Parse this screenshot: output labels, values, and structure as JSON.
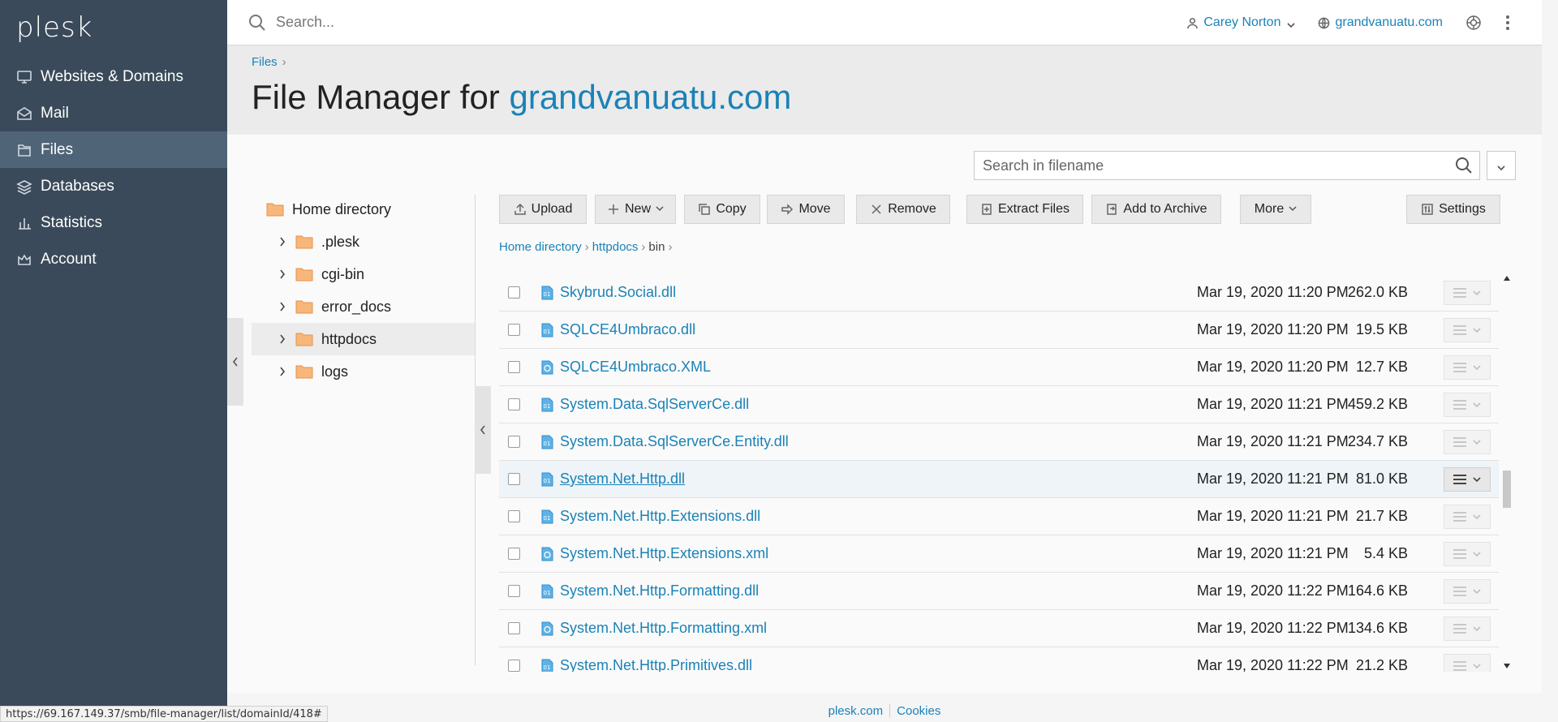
{
  "brand": {
    "logo": "plesk"
  },
  "sidebar": {
    "items": [
      {
        "label": "Websites & Domains",
        "icon": "monitor-icon",
        "active": false
      },
      {
        "label": "Mail",
        "icon": "envelope-icon",
        "active": false
      },
      {
        "label": "Files",
        "icon": "files-icon",
        "active": true
      },
      {
        "label": "Databases",
        "icon": "database-icon",
        "active": false
      },
      {
        "label": "Statistics",
        "icon": "bar-chart-icon",
        "active": false
      },
      {
        "label": "Account",
        "icon": "account-icon",
        "active": false
      }
    ]
  },
  "topbar": {
    "search_placeholder": "Search...",
    "user": "Carey Norton",
    "domain": "grandvanuatu.com"
  },
  "header": {
    "breadcrumb": "Files",
    "title_prefix": "File Manager for ",
    "title_domain": "grandvanuatu.com"
  },
  "search_filename": {
    "placeholder": "Search in filename"
  },
  "tree": {
    "root": "Home directory",
    "children": [
      ".plesk",
      "cgi-bin",
      "error_docs",
      "httpdocs",
      "logs"
    ],
    "selected": "httpdocs"
  },
  "toolbar": {
    "upload": "Upload",
    "new": "New",
    "copy": "Copy",
    "move": "Move",
    "remove": "Remove",
    "extract": "Extract Files",
    "archive": "Add to Archive",
    "more": "More",
    "settings": "Settings"
  },
  "path": {
    "home": "Home directory",
    "httpdocs": "httpdocs",
    "bin": "bin"
  },
  "files": [
    {
      "name": "Skybrud.Social.dll",
      "type": "dll",
      "date": "Mar 19, 2020 11:20 PM",
      "size": "262.0 KB"
    },
    {
      "name": "SQLCE4Umbraco.dll",
      "type": "dll",
      "date": "Mar 19, 2020 11:20 PM",
      "size": "19.5 KB"
    },
    {
      "name": "SQLCE4Umbraco.XML",
      "type": "xml",
      "date": "Mar 19, 2020 11:20 PM",
      "size": "12.7 KB"
    },
    {
      "name": "System.Data.SqlServerCe.dll",
      "type": "dll",
      "date": "Mar 19, 2020 11:21 PM",
      "size": "459.2 KB"
    },
    {
      "name": "System.Data.SqlServerCe.Entity.dll",
      "type": "dll",
      "date": "Mar 19, 2020 11:21 PM",
      "size": "234.7 KB"
    },
    {
      "name": "System.Net.Http.dll",
      "type": "dll",
      "date": "Mar 19, 2020 11:21 PM",
      "size": "81.0 KB",
      "hover": true
    },
    {
      "name": "System.Net.Http.Extensions.dll",
      "type": "dll",
      "date": "Mar 19, 2020 11:21 PM",
      "size": "21.7 KB"
    },
    {
      "name": "System.Net.Http.Extensions.xml",
      "type": "xml",
      "date": "Mar 19, 2020 11:21 PM",
      "size": "5.4 KB"
    },
    {
      "name": "System.Net.Http.Formatting.dll",
      "type": "dll",
      "date": "Mar 19, 2020 11:22 PM",
      "size": "164.6 KB"
    },
    {
      "name": "System.Net.Http.Formatting.xml",
      "type": "xml",
      "date": "Mar 19, 2020 11:22 PM",
      "size": "134.6 KB"
    },
    {
      "name": "System.Net.Http.Primitives.dll",
      "type": "dll",
      "date": "Mar 19, 2020 11:22 PM",
      "size": "21.2 KB"
    }
  ],
  "footer": {
    "link1": "plesk.com",
    "link2": "Cookies"
  },
  "status_url": "https://69.167.149.37/smb/file-manager/list/domainId/418#",
  "colors": {
    "sidebar": "#3a4a5a",
    "active": "#4f6477",
    "link": "#1b82b7",
    "folder": "#f0a050"
  }
}
